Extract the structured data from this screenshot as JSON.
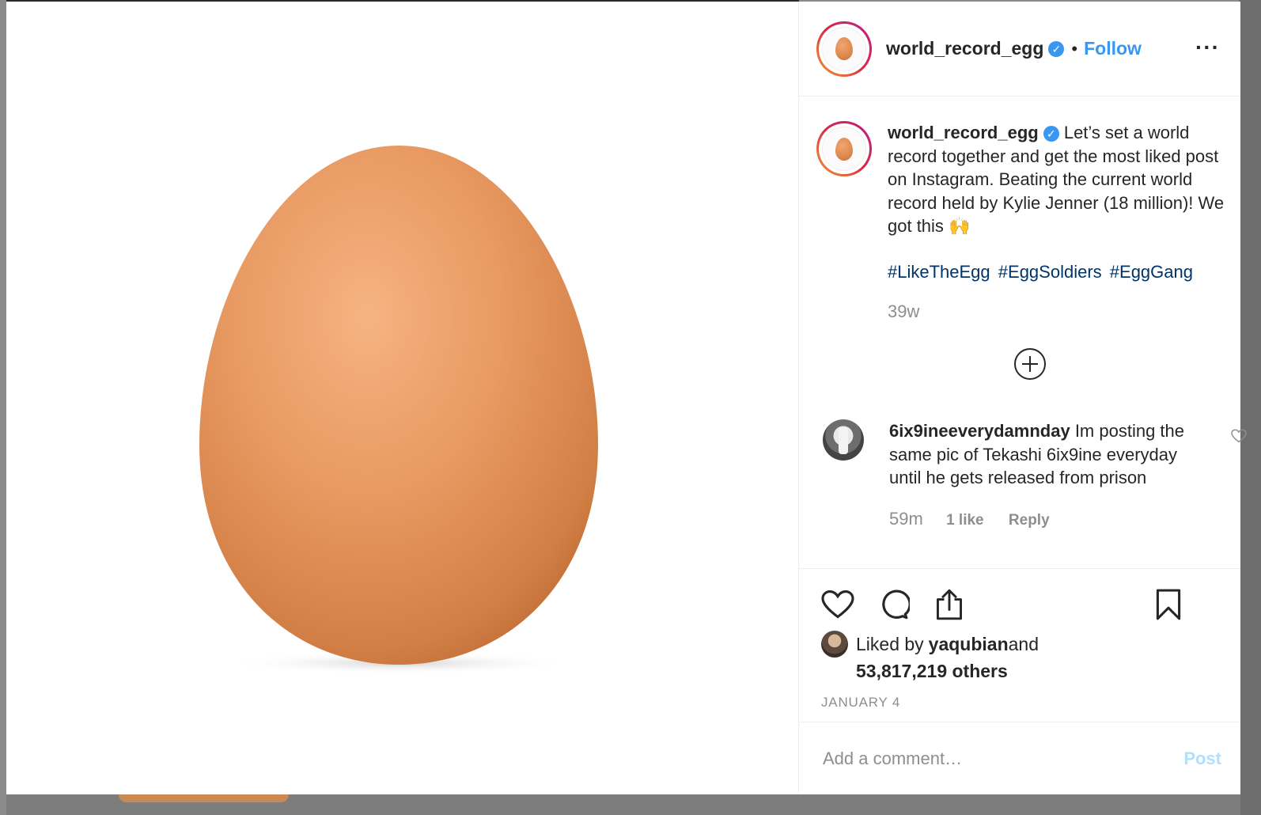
{
  "header": {
    "username": "world_record_egg",
    "verified_glyph": "✓",
    "separator": "•",
    "follow_label": "Follow",
    "more_label": "···"
  },
  "caption": {
    "username": "world_record_egg",
    "text": " Let’s set a world record together and get the most liked post on Instagram. Beating the current world record held by Kylie Jenner (18 million)! We got this 🙌",
    "hashtags": [
      "#LikeTheEgg",
      "#EggSoldiers",
      "#EggGang"
    ],
    "age": "39w"
  },
  "comment": {
    "username": "6ix9ineeverydamnday",
    "text": " Im posting the same pic of Tekashi 6ix9ine everyday until he gets released from prison",
    "age": "59m",
    "likes": "1 like",
    "reply_label": "Reply"
  },
  "likes": {
    "prefix": "Liked by ",
    "user": "yaqubian",
    "and": " and",
    "others": "53,817,219 others"
  },
  "date": "JANUARY 4",
  "add_comment": {
    "placeholder": "Add a comment…",
    "post_label": "Post"
  },
  "icons": {
    "like": "heart-icon",
    "comment": "comment-icon",
    "share": "share-icon",
    "save": "bookmark-icon",
    "new_comments": "plus-circle-icon"
  },
  "colors": {
    "link": "#3897f0",
    "hashtag": "#003569",
    "muted": "#8e8e8e",
    "egg": "#e58f55"
  }
}
